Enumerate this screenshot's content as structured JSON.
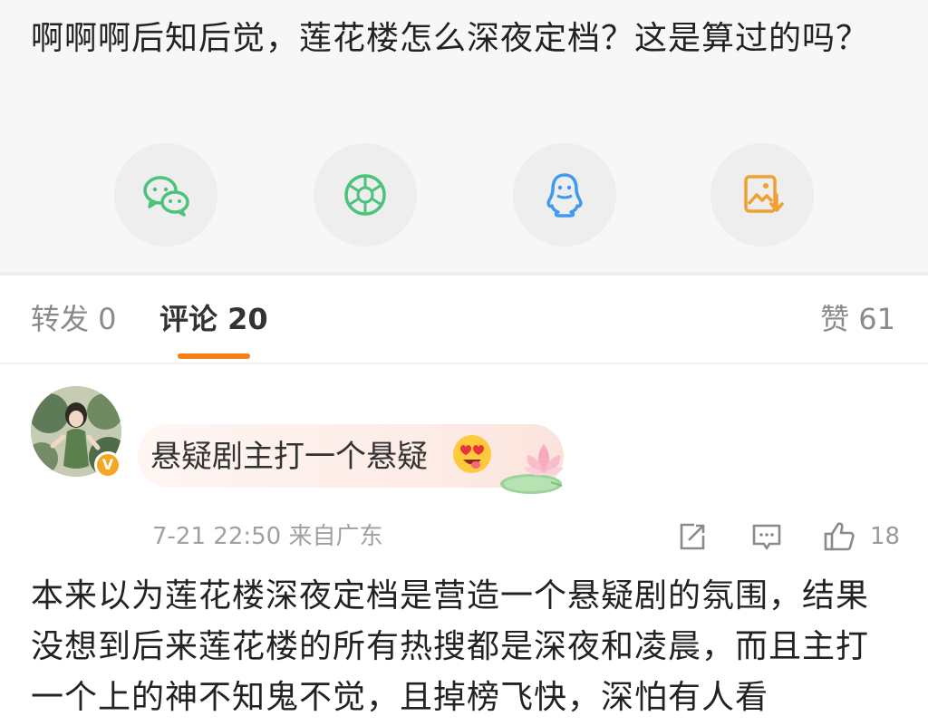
{
  "post": {
    "text": "啊啊啊后知后觉，莲花楼怎么深夜定档？这是算过的吗？"
  },
  "share": {
    "buttons": [
      {
        "icon": "wechat-icon",
        "color": "#4cc27a"
      },
      {
        "icon": "moments-icon",
        "color": "#4cc27a"
      },
      {
        "icon": "qq-icon",
        "color": "#3d9af0"
      },
      {
        "icon": "save-image-icon",
        "color": "#f0a030"
      }
    ]
  },
  "tabs": {
    "repost": "转发 0",
    "comments": "评论 20",
    "likes": "赞 61",
    "accent": "#f57f17"
  },
  "comment": {
    "bubble_text": "悬疑剧主打一个悬疑",
    "verified_badge": "V",
    "time_location": "7-21 22:50 来自广东",
    "like_count": "18",
    "body": "本来以为莲花楼深夜定档是营造一个悬疑剧的氛围，结果没想到后来莲花楼的所有热搜都是深夜和凌晨，而且主打一个上的神不知鬼不觉，且掉榜飞快，深怕有人看"
  }
}
